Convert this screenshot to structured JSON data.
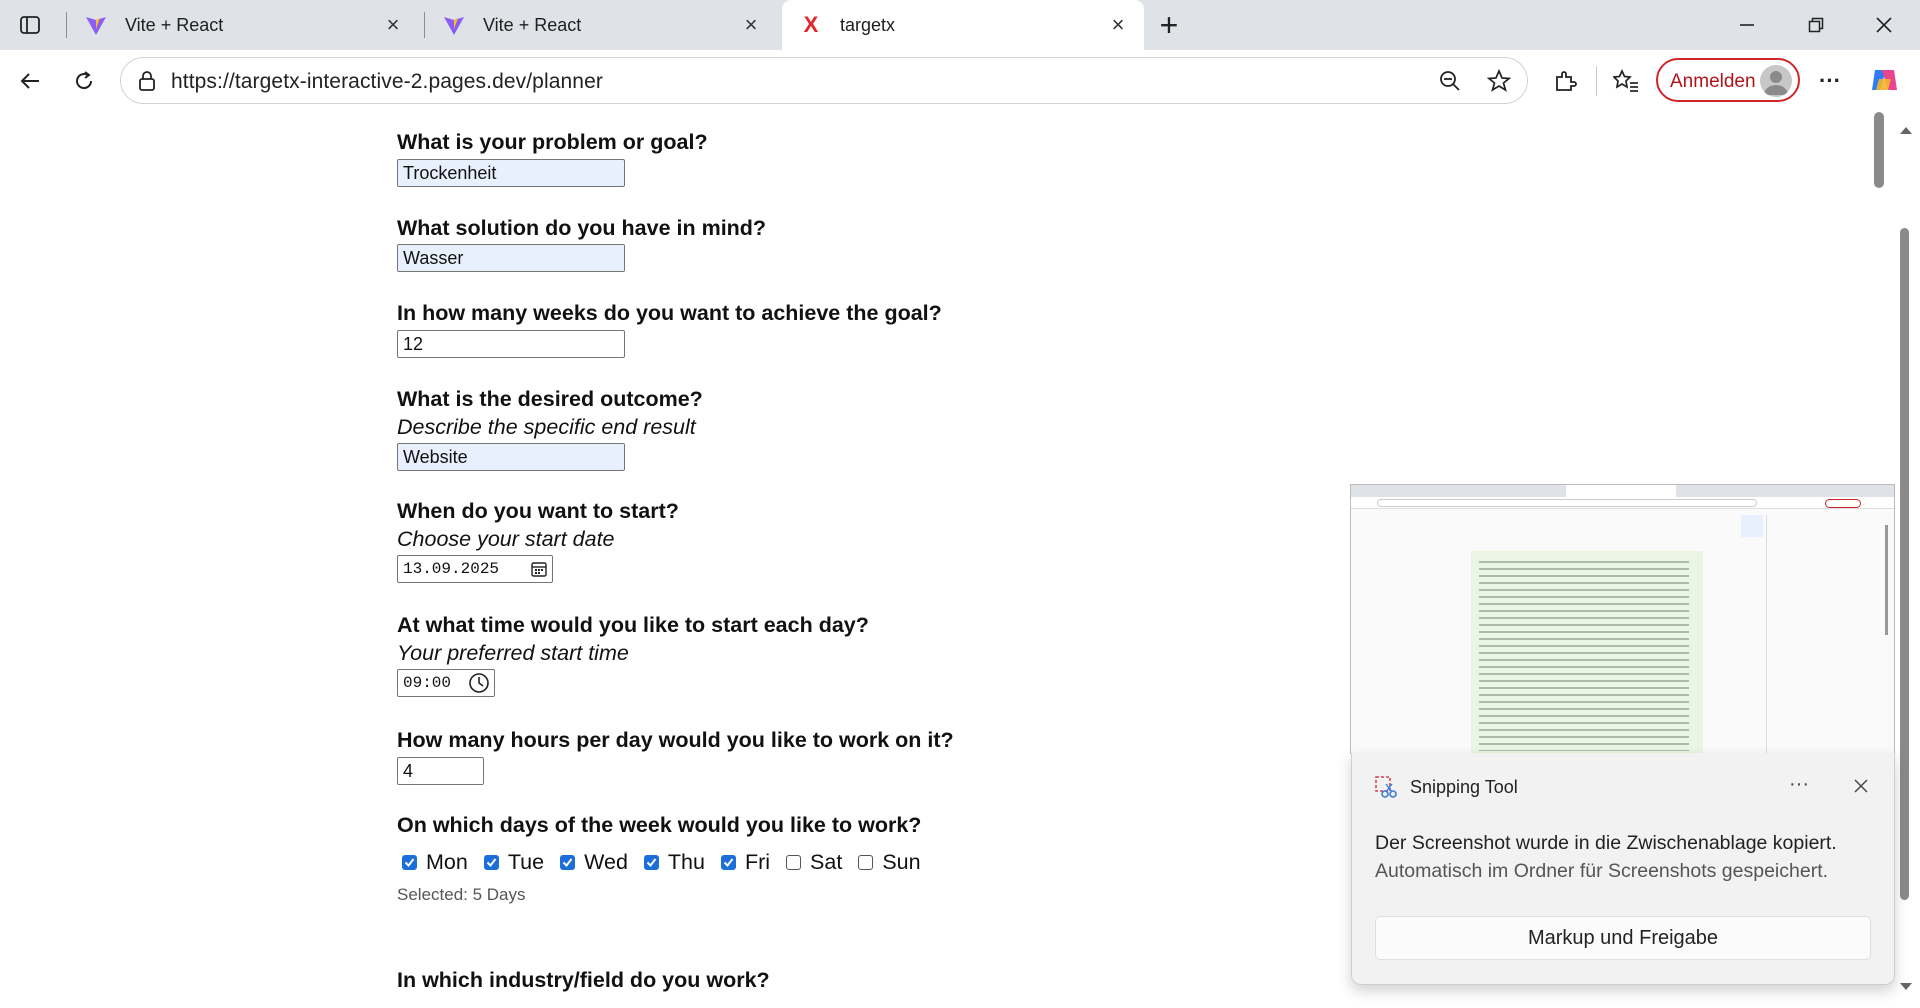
{
  "tabs": [
    {
      "title": "Vite + React",
      "icon": "vite-icon"
    },
    {
      "title": "Vite + React",
      "icon": "vite-icon"
    },
    {
      "title": "targetx",
      "icon": "targetx-x-icon",
      "active": true
    }
  ],
  "address": {
    "url": "https://targetx-interactive-2.pages.dev/planner"
  },
  "signin": {
    "label": "Anmelden"
  },
  "form": {
    "problem": {
      "question": "What is your problem or goal?",
      "value": "Trockenheit"
    },
    "solution": {
      "question": "What solution do you have in mind?",
      "value": "Wasser"
    },
    "weeks": {
      "question": "In how many weeks do you want to achieve the goal?",
      "value": "12"
    },
    "outcome": {
      "question": "What is the desired outcome?",
      "hint": "Describe the specific end result",
      "value": "Website"
    },
    "start": {
      "question": "When do you want to start?",
      "hint": "Choose your start date",
      "value": "13.09.2025"
    },
    "time": {
      "question": "At what time would you like to start each day?",
      "hint": "Your preferred start time",
      "value": "09:00"
    },
    "hours": {
      "question": "How many hours per day would you like to work on it?",
      "value": "4"
    },
    "days": {
      "question": "On which days of the week would you like to work?",
      "items": [
        {
          "label": "Mon",
          "checked": true
        },
        {
          "label": "Tue",
          "checked": true
        },
        {
          "label": "Wed",
          "checked": true
        },
        {
          "label": "Thu",
          "checked": true
        },
        {
          "label": "Fri",
          "checked": true
        },
        {
          "label": "Sat",
          "checked": false
        },
        {
          "label": "Sun",
          "checked": false
        }
      ],
      "selected": "Selected: 5 Days"
    },
    "industry": {
      "question": "In which industry/field do you work?"
    }
  },
  "snipping": {
    "app": "Snipping Tool",
    "message1": "Der Screenshot wurde in die Zwischenablage kopiert.",
    "message2": "Automatisch im Ordner für Screenshots gespeichert.",
    "button": "Markup und Freigabe"
  },
  "colors": {
    "accent": "#1c6edb",
    "signin": "#d0262b",
    "autofill": "#e8f0fe"
  }
}
